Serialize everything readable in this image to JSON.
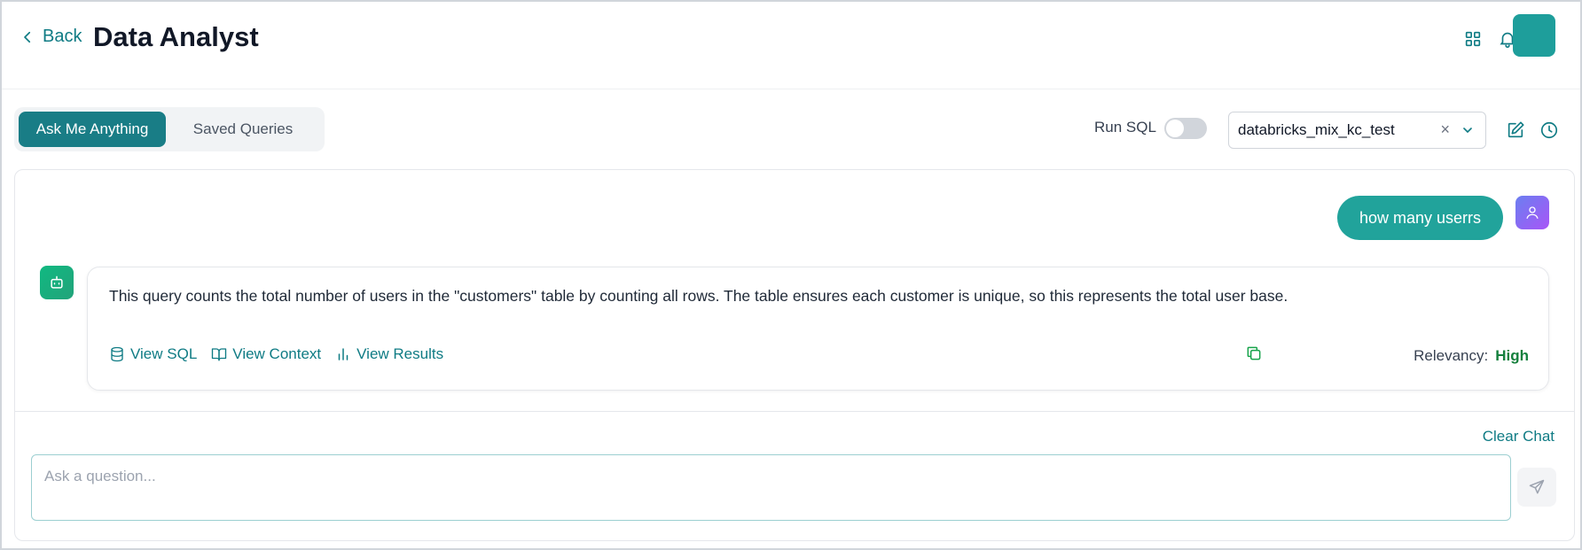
{
  "header": {
    "back_label": "Back",
    "title": "Data Analyst",
    "icons": [
      "grid-icon",
      "bell-icon"
    ]
  },
  "toolbar": {
    "tabs": [
      {
        "label": "Ask Me Anything",
        "active": true
      },
      {
        "label": "Saved Queries",
        "active": false
      }
    ],
    "run_sql_label": "Run SQL",
    "run_sql_on": false,
    "datasource": "databricks_mix_kc_test",
    "clear_glyph": "×"
  },
  "chat": {
    "user_message": "how many userrs",
    "bot_message": "This query counts the total number of users in the \"customers\" table by counting all rows. The table ensures each customer is unique, so this represents the total user base.",
    "actions": [
      "View SQL",
      "View Context",
      "View Results"
    ],
    "relevancy_label": "Relevancy:",
    "relevancy_value": "High",
    "clear_chat": "Clear Chat",
    "input_placeholder": "Ask a question..."
  },
  "colors": {
    "accent": "#197d86",
    "user_bubble": "#21a39b",
    "relevancy_high": "#15803d"
  }
}
